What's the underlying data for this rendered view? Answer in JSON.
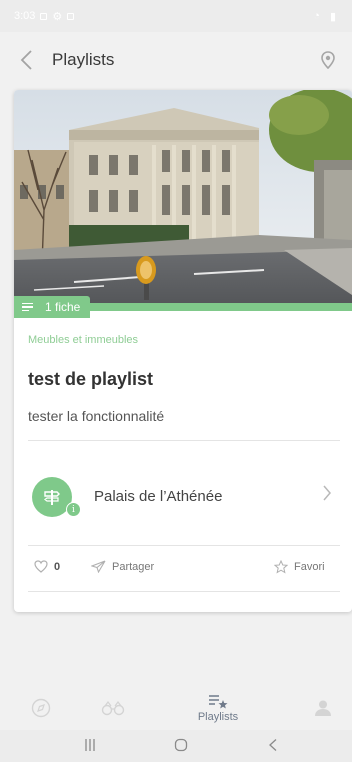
{
  "status_bar": {
    "time": "3:03"
  },
  "header": {
    "title": "Playlists",
    "back_icon": "chevron-left-icon",
    "location_icon": "map-pin-icon"
  },
  "card": {
    "fiche_count": "1 fiche",
    "category": "Meubles et immeubles",
    "title": "test de playlist",
    "description": "tester la fonctionnalité",
    "place": {
      "name": "Palais de l’Athénée"
    },
    "actions": {
      "likes": "0",
      "share_label": "Partager",
      "favorite_label": "Favori"
    }
  },
  "bottom_nav": {
    "active_label": "Playlists"
  },
  "colors": {
    "accent_green": "#80c98a",
    "category_green": "#8fcd95"
  }
}
